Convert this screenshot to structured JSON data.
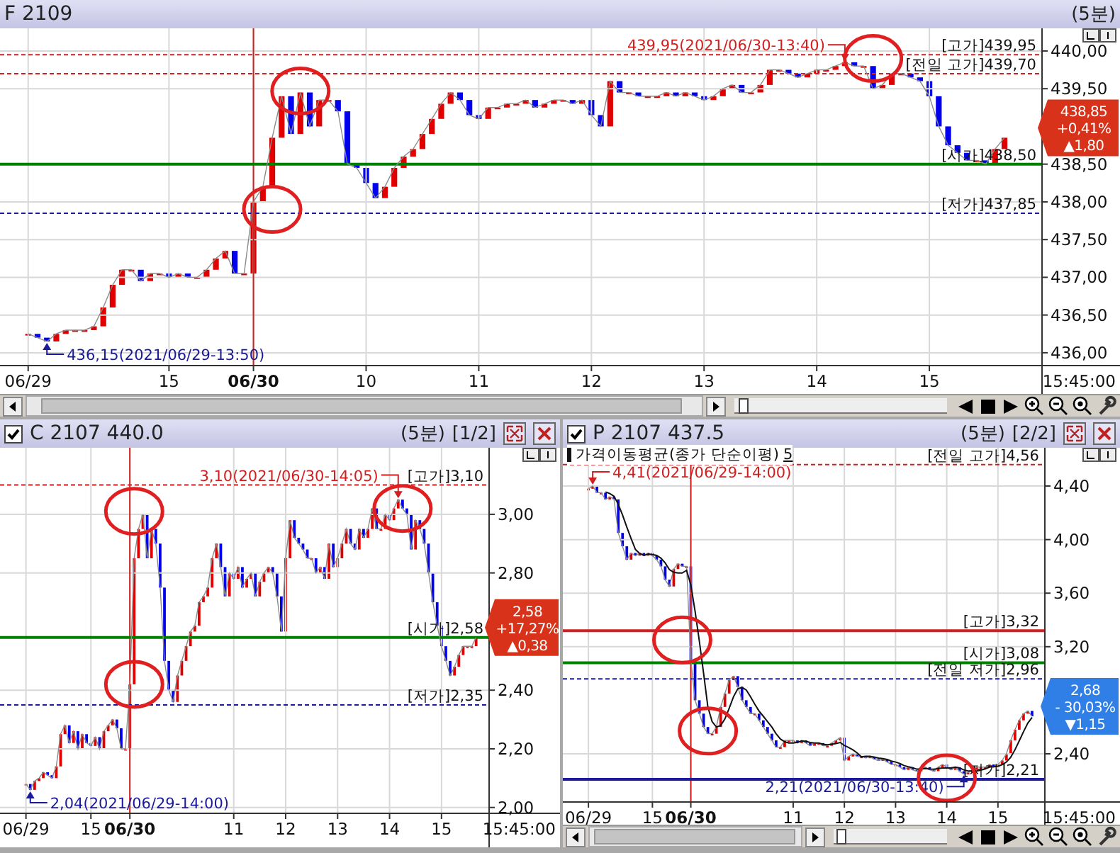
{
  "panels": [
    {
      "title": "F 2109",
      "interval": "(5분)",
      "cursor_time": "15:45:00",
      "scrollbar": true,
      "slider": {
        "level": 0.02
      },
      "badge": {
        "price": "438,85",
        "change_pct": "+0,41%",
        "change": "▲1,80",
        "rising": true
      },
      "chart_data": {
        "type": "line",
        "grid": true,
        "ylim": [
          435.83,
          440.3
        ],
        "categories": [
          "06/29",
          null,
          null,
          null,
          null,
          null,
          null,
          null,
          null,
          null,
          null,
          null,
          null,
          null,
          null,
          "15",
          null,
          null,
          null,
          null,
          null,
          null,
          null,
          null,
          "06/30",
          null,
          null,
          null,
          null,
          null,
          null,
          null,
          null,
          null,
          null,
          null,
          "10",
          null,
          null,
          null,
          null,
          null,
          null,
          null,
          null,
          null,
          null,
          null,
          "11",
          null,
          null,
          null,
          null,
          null,
          null,
          null,
          null,
          null,
          null,
          null,
          "12",
          null,
          null,
          null,
          null,
          null,
          null,
          null,
          null,
          null,
          null,
          null,
          "13",
          null,
          null,
          null,
          null,
          null,
          null,
          null,
          null,
          null,
          null,
          null,
          "14",
          null,
          null,
          null,
          null,
          null,
          null,
          null,
          null,
          null,
          null,
          null,
          "15",
          null,
          null,
          null,
          null,
          null,
          null,
          null,
          null
        ],
        "values": [
          436.25,
          436.2,
          436.15,
          436.25,
          436.3,
          436.3,
          436.3,
          436.35,
          436.6,
          436.9,
          437.1,
          437.1,
          436.95,
          437.05,
          437.05,
          437.0,
          437.05,
          437.0,
          437.0,
          437.1,
          437.25,
          437.35,
          437.05,
          437.05,
          438.0,
          438.2,
          438.85,
          439.4,
          438.9,
          439.45,
          439.0,
          439.35,
          439.35,
          439.2,
          438.5,
          438.45,
          438.25,
          438.05,
          438.2,
          438.45,
          438.6,
          438.7,
          438.9,
          439.1,
          439.3,
          439.45,
          439.35,
          439.15,
          439.1,
          439.25,
          439.25,
          439.3,
          439.3,
          439.35,
          439.25,
          439.3,
          439.35,
          439.35,
          439.3,
          439.35,
          439.15,
          439.0,
          439.6,
          439.45,
          439.45,
          439.4,
          439.4,
          439.4,
          439.45,
          439.4,
          439.45,
          439.4,
          439.35,
          439.4,
          439.5,
          439.55,
          439.45,
          439.45,
          439.55,
          439.75,
          439.75,
          439.7,
          439.65,
          439.7,
          439.75,
          439.75,
          439.8,
          439.85,
          439.8,
          439.8,
          439.5,
          439.55,
          439.7,
          439.7,
          439.65,
          439.6,
          439.4,
          439.0,
          438.75,
          438.65,
          438.55,
          438.55,
          438.5,
          438.7,
          438.85
        ],
        "yticks": [
          {
            "value": 440,
            "label": "440,00"
          },
          {
            "value": 439.5,
            "label": "439,50"
          },
          {
            "value": 438.5,
            "label": "438,50"
          },
          {
            "value": 438,
            "label": "438,00"
          },
          {
            "value": 437.5,
            "label": "437,50"
          },
          {
            "value": 437,
            "label": "437,00"
          },
          {
            "value": 436.5,
            "label": "436,50"
          },
          {
            "value": 436,
            "label": "436,00"
          }
        ],
        "ref_lines": [
          {
            "axis": "y",
            "value": 439.95,
            "label": "[고가]439,95",
            "color": "#d02020"
          },
          {
            "axis": "y",
            "value": 439.7,
            "label": "[전일 고가]439,70",
            "color": "#d02020"
          },
          {
            "axis": "y",
            "value": 438.5,
            "label": "[시가]438,50",
            "color": "#008000"
          },
          {
            "axis": "y",
            "value": 437.85,
            "label": "[저가]437,85",
            "color": "#1a1a9a"
          }
        ],
        "annotations": [
          "439,95(2021/06/30-13:40)",
          "436,15(2021/06/29-13:50)"
        ]
      }
    },
    {
      "title": "C 2107 440.0",
      "checked": true,
      "interval": "(5분)",
      "page": "[1/2]",
      "window_buttons": true,
      "cursor_time": "15:45:00",
      "scrollbar": false,
      "badge": {
        "price": "2,58",
        "change_pct": "+17,27%",
        "change": "▲0,38",
        "rising": true
      },
      "chart_data": {
        "type": "line",
        "grid": true,
        "ylim": [
          1.98,
          3.227
        ],
        "categories": [
          "06/29",
          null,
          null,
          null,
          null,
          null,
          null,
          null,
          null,
          null,
          null,
          null,
          null,
          null,
          null,
          "15",
          null,
          null,
          null,
          null,
          null,
          null,
          null,
          null,
          "06/30",
          null,
          null,
          null,
          null,
          null,
          null,
          null,
          null,
          null,
          null,
          null,
          null,
          null,
          null,
          null,
          null,
          null,
          null,
          null,
          null,
          null,
          null,
          null,
          "11",
          null,
          null,
          null,
          null,
          null,
          null,
          null,
          null,
          null,
          null,
          null,
          "12",
          null,
          null,
          null,
          null,
          null,
          null,
          null,
          null,
          null,
          null,
          null,
          "13",
          null,
          null,
          null,
          null,
          null,
          null,
          null,
          null,
          null,
          null,
          null,
          "14",
          null,
          null,
          null,
          null,
          null,
          null,
          null,
          null,
          null,
          null,
          null,
          "15",
          null,
          null,
          null,
          null,
          null,
          null,
          null,
          null
        ],
        "values": [
          2.08,
          2.06,
          2.09,
          2.1,
          2.12,
          2.11,
          2.1,
          2.14,
          2.25,
          2.28,
          2.22,
          2.26,
          2.2,
          2.25,
          2.22,
          2.21,
          2.24,
          2.2,
          2.26,
          2.28,
          2.3,
          2.27,
          2.2,
          2.2,
          2.42,
          2.85,
          2.95,
          3.0,
          2.85,
          2.95,
          2.9,
          2.75,
          2.5,
          2.4,
          2.36,
          2.45,
          2.5,
          2.55,
          2.6,
          2.62,
          2.7,
          2.72,
          2.75,
          2.85,
          2.9,
          2.82,
          2.72,
          2.8,
          2.78,
          2.82,
          2.75,
          2.78,
          2.8,
          2.72,
          2.77,
          2.8,
          2.82,
          2.8,
          2.72,
          2.6,
          2.85,
          2.98,
          2.92,
          2.9,
          2.88,
          2.85,
          2.85,
          2.8,
          2.82,
          2.78,
          2.9,
          2.82,
          2.85,
          2.9,
          2.95,
          2.9,
          2.88,
          2.95,
          2.92,
          2.95,
          3.02,
          2.95,
          2.95,
          3.0,
          2.98,
          3.02,
          3.05,
          3.02,
          3.0,
          2.88,
          2.98,
          2.95,
          2.9,
          2.8,
          2.7,
          2.62,
          2.55,
          2.5,
          2.45,
          2.48,
          2.52,
          2.55,
          2.55,
          2.55,
          2.58
        ],
        "yticks": [
          {
            "value": 3,
            "label": "3,00"
          },
          {
            "value": 2.8,
            "label": "2,80"
          },
          {
            "value": 2.4,
            "label": "2,40"
          },
          {
            "value": 2.2,
            "label": "2,20"
          },
          {
            "value": 2,
            "label": "2,00"
          }
        ],
        "ref_lines": [
          {
            "axis": "y",
            "value": 3.1,
            "label": "[고가]3,10",
            "color": "#d02020"
          },
          {
            "axis": "y",
            "value": 2.58,
            "label": "[시가]2,58",
            "color": "#008000"
          },
          {
            "axis": "y",
            "value": 2.35,
            "label": "[저가]2,35",
            "color": "#1a1a9a"
          }
        ],
        "annotations": [
          "3,10(2021/06/30-14:05)",
          "2,04(2021/06/29-14:00)"
        ]
      }
    },
    {
      "title": "P 2107 437.5",
      "checked": true,
      "interval": "(5분)",
      "page": "[2/2]",
      "window_buttons": true,
      "cursor_time": "15:45:00",
      "scrollbar": true,
      "slider": {
        "level": 0.02
      },
      "moving_average": {
        "period": "5"
      },
      "badge": {
        "price": "2,68",
        "change_pct": "- 30,03%",
        "change": "▼1,15",
        "rising": false
      },
      "chart_data": {
        "type": "line",
        "grid": true,
        "ylim": [
          2.04,
          4.686
        ],
        "categories": [
          "06/29",
          null,
          null,
          null,
          null,
          null,
          null,
          null,
          null,
          null,
          null,
          null,
          null,
          null,
          null,
          "15",
          null,
          null,
          null,
          null,
          null,
          null,
          null,
          null,
          "06/30",
          null,
          null,
          null,
          null,
          null,
          null,
          null,
          null,
          null,
          null,
          null,
          null,
          null,
          null,
          null,
          null,
          null,
          null,
          null,
          null,
          null,
          null,
          null,
          "11",
          null,
          null,
          null,
          null,
          null,
          null,
          null,
          null,
          null,
          null,
          null,
          "12",
          null,
          null,
          null,
          null,
          null,
          null,
          null,
          null,
          null,
          null,
          null,
          "13",
          null,
          null,
          null,
          null,
          null,
          null,
          null,
          null,
          null,
          null,
          null,
          "14",
          null,
          null,
          null,
          null,
          null,
          null,
          null,
          null,
          null,
          null,
          null,
          "15",
          null,
          null,
          null,
          null,
          null,
          null,
          null,
          null
        ],
        "series": [
          {
            "values": [
              4.38,
              4.4,
              4.35,
              4.35,
              4.3,
              4.32,
              4.3,
              4.05,
              3.95,
              3.85,
              3.9,
              3.88,
              3.9,
              3.88,
              3.9,
              3.88,
              3.85,
              3.8,
              3.7,
              3.65,
              3.78,
              3.82,
              3.8,
              3.8,
              3.1,
              2.8,
              2.7,
              2.6,
              2.55,
              2.55,
              2.6,
              2.75,
              2.85,
              2.95,
              2.98,
              2.9,
              2.8,
              2.75,
              2.7,
              2.7,
              2.65,
              2.6,
              2.55,
              2.5,
              2.45,
              2.45,
              2.5,
              2.5,
              2.5,
              2.48,
              2.5,
              2.48,
              2.46,
              2.48,
              2.48,
              2.46,
              2.46,
              2.48,
              2.5,
              2.52,
              2.35,
              2.38,
              2.4,
              2.38,
              2.38,
              2.37,
              2.38,
              2.36,
              2.35,
              2.36,
              2.34,
              2.32,
              2.32,
              2.3,
              2.28,
              2.3,
              2.28,
              2.27,
              2.3,
              2.3,
              2.28,
              2.27,
              2.3,
              2.32,
              2.3,
              2.28,
              2.3,
              2.27,
              2.25,
              2.26,
              2.28,
              2.3,
              2.3,
              2.3,
              2.32,
              2.3,
              2.32,
              2.35,
              2.4,
              2.5,
              2.58,
              2.65,
              2.7,
              2.72,
              2.68
            ]
          },
          {
            "name": "가격이동평균(종가 단순이평)",
            "values": [
              null,
              null,
              null,
              null,
              4.356,
              4.344,
              4.324,
              4.264,
              4.184,
              4.094,
              4.01,
              3.926,
              3.896,
              3.882,
              3.892,
              3.888,
              3.882,
              3.862,
              3.826,
              3.776,
              3.756,
              3.75,
              3.75,
              3.77,
              3.66,
              3.464,
              3.24,
              3.0,
              2.75,
              2.64,
              2.6,
              2.61,
              2.66,
              2.74,
              2.826,
              2.886,
              2.896,
              2.876,
              2.826,
              2.77,
              2.72,
              2.68,
              2.64,
              2.6,
              2.55,
              2.51,
              2.49,
              2.48,
              2.48,
              2.486,
              2.496,
              2.492,
              2.484,
              2.48,
              2.48,
              2.472,
              2.468,
              2.472,
              2.476,
              2.484,
              2.462,
              2.446,
              2.43,
              2.406,
              2.378,
              2.382,
              2.382,
              2.374,
              2.368,
              2.364,
              2.358,
              2.346,
              2.338,
              2.328,
              2.312,
              2.304,
              2.296,
              2.286,
              2.286,
              2.29,
              2.286,
              2.284,
              2.29,
              2.294,
              2.294,
              2.294,
              2.3,
              2.294,
              2.28,
              2.272,
              2.272,
              2.272,
              2.278,
              2.288,
              2.3,
              2.304,
              2.308,
              2.318,
              2.338,
              2.374,
              2.43,
              2.496,
              2.566,
              2.63,
              2.672
            ]
          }
        ],
        "yticks": [
          {
            "value": 4.4,
            "label": "4,40"
          },
          {
            "value": 4,
            "label": "4,00"
          },
          {
            "value": 3.6,
            "label": "3,60"
          },
          {
            "value": 3.2,
            "label": "3,20"
          },
          {
            "value": 2.4,
            "label": "2,40"
          }
        ],
        "ref_lines": [
          {
            "axis": "y",
            "value": 4.56,
            "label": "[전일 고가]4,56",
            "color": "#d02020"
          },
          {
            "axis": "y",
            "value": 3.32,
            "label": "[고가]3,32",
            "color": "#d02020"
          },
          {
            "axis": "y",
            "value": 3.08,
            "label": "[시가]3,08",
            "color": "#008000"
          },
          {
            "axis": "y",
            "value": 2.96,
            "label": "[전일 저가]2,96",
            "color": "#1a1a9a"
          },
          {
            "axis": "y",
            "value": 2.21,
            "label": "[저가]2,21",
            "color": "#1a1a9a"
          }
        ],
        "annotations": [
          "4,41(2021/06/29-14:00)",
          "2,21(2021/06/30-13:40)"
        ]
      }
    }
  ]
}
